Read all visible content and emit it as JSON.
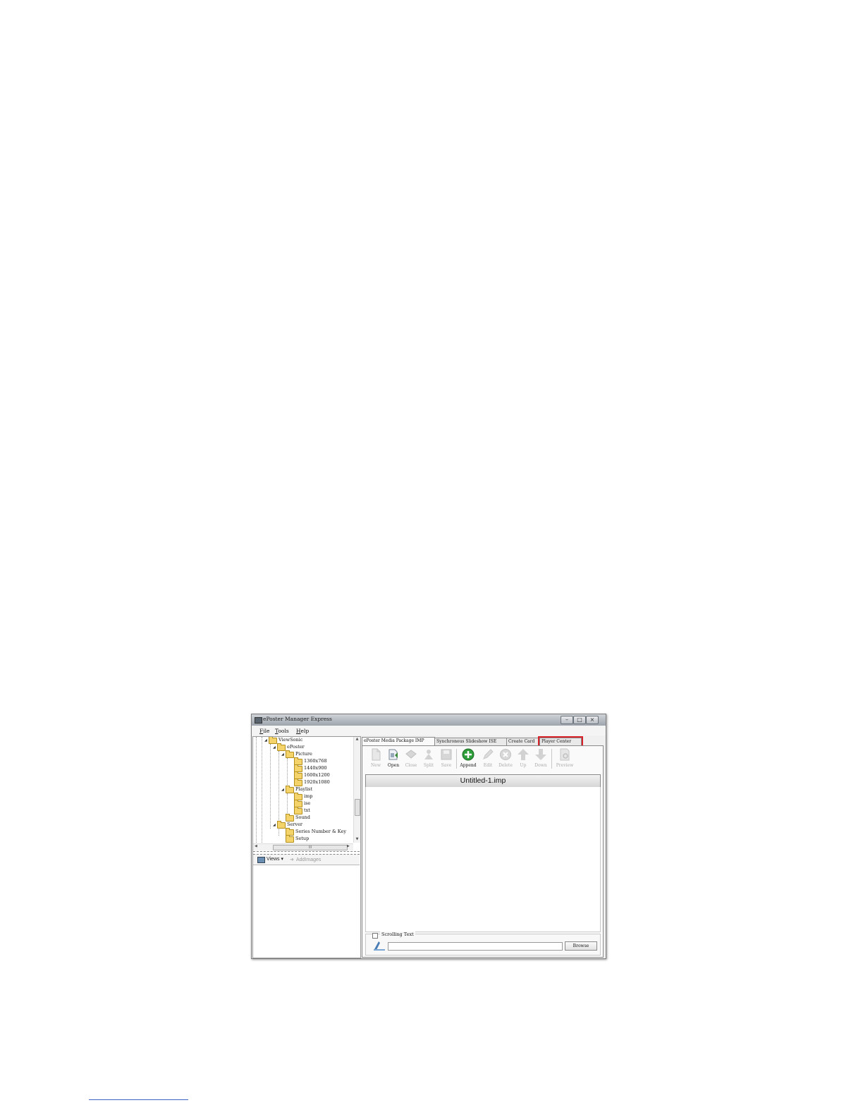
{
  "window": {
    "title": "ePoster Manager Express",
    "controls": {
      "minimize": "–",
      "maximize": "□",
      "close": "×"
    }
  },
  "menu": {
    "items": [
      "File",
      "Tools",
      "Help"
    ]
  },
  "tree": {
    "nodes": [
      {
        "label": "ViewSonic",
        "level": 0,
        "expanded": true
      },
      {
        "label": "ePoster",
        "level": 1,
        "expanded": true
      },
      {
        "label": "Picture",
        "level": 2,
        "expanded": true
      },
      {
        "label": "1360x768",
        "level": 3
      },
      {
        "label": "1440x900",
        "level": 3
      },
      {
        "label": "1600x1200",
        "level": 3
      },
      {
        "label": "1920x1080",
        "level": 3
      },
      {
        "label": "Playlist",
        "level": 2,
        "expanded": true
      },
      {
        "label": "imp",
        "level": 3
      },
      {
        "label": "ise",
        "level": 3
      },
      {
        "label": "txt",
        "level": 3
      },
      {
        "label": "Sound",
        "level": 2
      },
      {
        "label": "Server",
        "level": 1,
        "expanded": true
      },
      {
        "label": "Series Number & Key",
        "level": 2
      },
      {
        "label": "Setup",
        "level": 2
      }
    ],
    "hscroll_grip": "III"
  },
  "views_bar": {
    "views_label": "Views ▾",
    "add_images_label": "AddImages"
  },
  "tabs": [
    {
      "label": "ePoster Media Package IMP",
      "active": true
    },
    {
      "label": "Synchronous Slideshow ISE",
      "active": false
    },
    {
      "label": "Create Card",
      "active": false
    },
    {
      "label": "Player Center",
      "active": false,
      "highlighted": true
    }
  ],
  "toolbar": {
    "buttons": [
      {
        "label": "New",
        "icon": "new-document-icon",
        "enabled": false
      },
      {
        "label": "Open",
        "icon": "open-icon",
        "enabled": true
      },
      {
        "label": "Close",
        "icon": "close-package-icon",
        "enabled": false
      },
      {
        "label": "Split",
        "icon": "split-icon",
        "enabled": false
      },
      {
        "label": "Save",
        "icon": "save-icon",
        "enabled": false
      },
      {
        "label": "Append",
        "icon": "append-icon",
        "enabled": true
      },
      {
        "label": "Edit",
        "icon": "edit-icon",
        "enabled": false
      },
      {
        "label": "Delete",
        "icon": "delete-icon",
        "enabled": false
      },
      {
        "label": "Up",
        "icon": "arrow-up-icon",
        "enabled": false
      },
      {
        "label": "Down",
        "icon": "arrow-down-icon",
        "enabled": false
      },
      {
        "label": "Preview",
        "icon": "preview-icon",
        "enabled": false
      }
    ]
  },
  "document": {
    "title": "Untitled-1.imp"
  },
  "scrolling_text": {
    "checkbox_label": "Scrolling Text",
    "checked": false,
    "value": "",
    "browse_label": "Browse"
  },
  "colors": {
    "highlight": "#d9232a",
    "append_green": "#2e9e3a"
  }
}
